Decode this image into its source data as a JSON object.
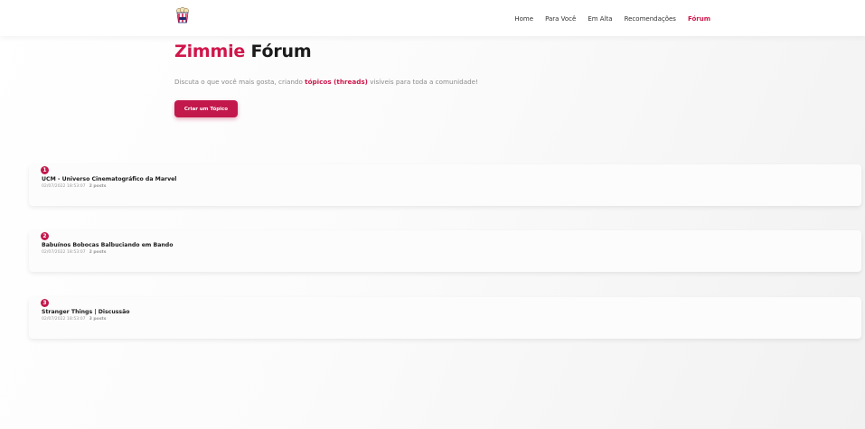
{
  "nav": {
    "logo_icon": "popcorn-logo-icon",
    "links": [
      {
        "label": "Home"
      },
      {
        "label": "Para Você"
      },
      {
        "label": "Em Alta"
      },
      {
        "label": "Recomendações"
      },
      {
        "label": "Fórum"
      }
    ],
    "active_link": "Fórum"
  },
  "hero": {
    "title_brand": "Zimmie",
    "title_rest": "Fórum",
    "desc_before": "Discuta o que você mais gosta, criando ",
    "desc_highlight": "tópicos (threads)",
    "desc_after": " visíveis para toda a comunidade!",
    "create_button": "Criar um Tópico"
  },
  "threads": [
    {
      "number": "1",
      "title": "UCM - Universo Cinematográfico da Marvel",
      "date": "02/07/2022 18:53:07",
      "posts": "2 posts"
    },
    {
      "number": "2",
      "title": "Babuínos Bobocas Balbuciando em Bando",
      "date": "02/07/2022 18:53:07",
      "posts": "2 posts"
    },
    {
      "number": "3",
      "title": "Stranger Things | Discussão",
      "date": "02/07/2022 18:53:07",
      "posts": "3 posts"
    }
  ],
  "colors": {
    "accent": "#d0164b",
    "button": "#c2184c",
    "text": "#1b1b1b",
    "muted": "#9a9a9a"
  }
}
